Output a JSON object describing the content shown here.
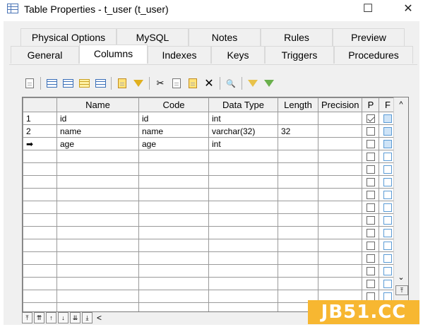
{
  "window": {
    "title": "Table Properties - t_user (t_user)",
    "controls": {
      "maximize": "☐",
      "close": "✕"
    }
  },
  "tabs_top": [
    "Physical Options",
    "MySQL",
    "Notes",
    "Rules",
    "Preview"
  ],
  "tabs_bottom": [
    "General",
    "Columns",
    "Indexes",
    "Keys",
    "Triggers",
    "Procedures"
  ],
  "active_tab": "Columns",
  "toolbar": {
    "icons": [
      "properties-icon",
      "add-row-icon",
      "insert-row-icon",
      "add-rows-icon",
      "modify-icon",
      "copy-row-icon",
      "paste-row-icon",
      "cut-icon",
      "copy-icon",
      "paste-icon",
      "delete-icon",
      "find-icon",
      "filter-icon",
      "clear-filter-icon"
    ],
    "glyphs": {
      "cut": "✂",
      "delete": "✕",
      "find": "🔍"
    }
  },
  "grid": {
    "headers": [
      "",
      "Name",
      "Code",
      "Data Type",
      "Length",
      "Precision",
      "P",
      "F",
      ""
    ],
    "rows": [
      {
        "num": "1",
        "name": "id",
        "code": "id",
        "type": "int",
        "length": "",
        "precision": "",
        "p": true,
        "f": false
      },
      {
        "num": "2",
        "name": "name",
        "code": "name",
        "type": "varchar(32)",
        "length": "32",
        "precision": "",
        "p": false,
        "f": false
      },
      {
        "num": "➡",
        "name": "age",
        "code": "age",
        "type": "int",
        "length": "",
        "precision": "",
        "p": false,
        "f": false
      }
    ],
    "empty_rows": 13
  },
  "scrollbar": {
    "up": "^",
    "down": "⌄"
  },
  "nav": {
    "buttons": [
      "⤒",
      "⇈",
      "↑",
      "↓",
      "⇊",
      "⤓"
    ],
    "left": "<"
  },
  "watermark": "JB51.CC"
}
